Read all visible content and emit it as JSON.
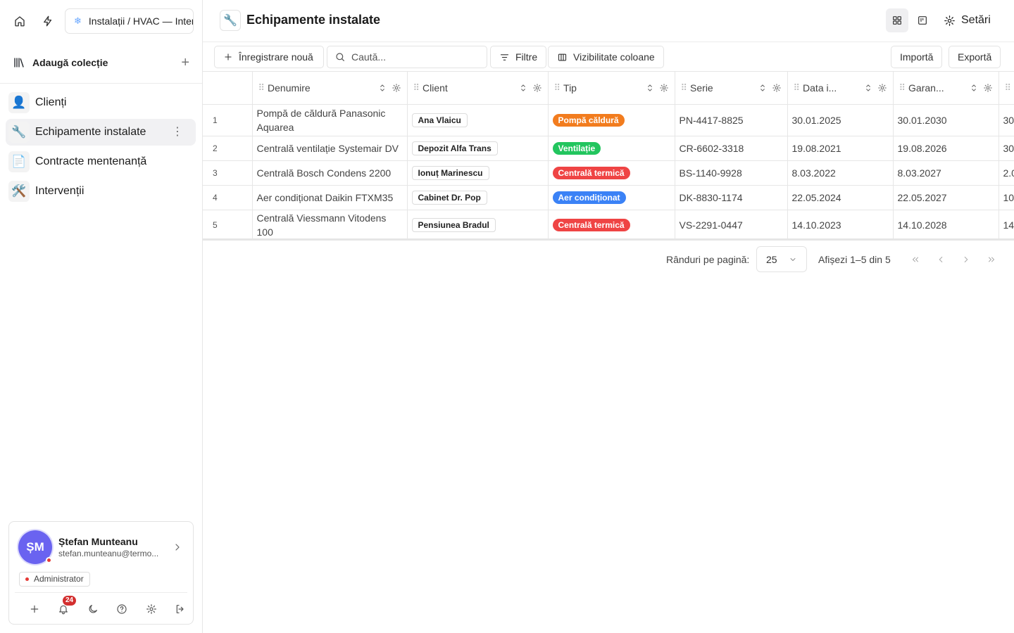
{
  "workspace": {
    "name": "Instalații / HVAC — Interne"
  },
  "sidebar": {
    "collections_label": "Adaugă colecție",
    "items": [
      {
        "emoji": "👤",
        "label": "Clienți"
      },
      {
        "emoji": "🔧",
        "label": "Echipamente instalate"
      },
      {
        "emoji": "📄",
        "label": "Contracte mentenanță"
      },
      {
        "emoji": "🛠️",
        "label": "Intervenții"
      }
    ]
  },
  "user": {
    "initials": "ȘM",
    "name": "Ștefan Munteanu",
    "email": "stefan.munteanu@termo...",
    "role": "Administrator",
    "notifications": "24"
  },
  "header": {
    "icon": "🔧",
    "title": "Echipamente instalate",
    "settings_label": "Setări"
  },
  "toolbar": {
    "new_record": "Înregistrare nouă",
    "search_placeholder": "Caută...",
    "filters": "Filtre",
    "columns": "Vizibilitate coloane",
    "import": "Importă",
    "export": "Exportă"
  },
  "table": {
    "columns": [
      "Denumire",
      "Client",
      "Tip",
      "Serie",
      "Data i...",
      "Garan..."
    ],
    "rows": [
      {
        "idx": "1",
        "name": "Pompă de căldură Panasonic Aquarea",
        "client": "Ana Vlaicu",
        "type": "Pompă căldură",
        "type_color": "#f27c1e",
        "serial": "PN-4417-8825",
        "date": "30.01.2025",
        "warranty": "30.01.2030",
        "extra": "30"
      },
      {
        "idx": "2",
        "name": "Centrală ventilație Systemair DV",
        "client": "Depozit Alfa Trans",
        "type": "Ventilație",
        "type_color": "#22c55e",
        "serial": "CR-6602-3318",
        "date": "19.08.2021",
        "warranty": "19.08.2026",
        "extra": "30"
      },
      {
        "idx": "3",
        "name": "Centrală Bosch Condens 2200",
        "client": "Ionuț Marinescu",
        "type": "Centrală termică",
        "type_color": "#ef4444",
        "serial": "BS-1140-9928",
        "date": "8.03.2022",
        "warranty": "8.03.2027",
        "extra": "2.0"
      },
      {
        "idx": "4",
        "name": "Aer condiționat Daikin FTXM35",
        "client": "Cabinet Dr. Pop",
        "type": "Aer condiționat",
        "type_color": "#3b82f6",
        "serial": "DK-8830-1174",
        "date": "22.05.2024",
        "warranty": "22.05.2027",
        "extra": "10"
      },
      {
        "idx": "5",
        "name": "Centrală Viessmann Vitodens 100",
        "client": "Pensiunea Bradul",
        "type": "Centrală termică",
        "type_color": "#ef4444",
        "serial": "VS-2291-0447",
        "date": "14.10.2023",
        "warranty": "14.10.2028",
        "extra": "14"
      }
    ]
  },
  "pagination": {
    "rows_per_page_label": "Rânduri pe pagină:",
    "rows_per_page": "25",
    "range": "Afișezi 1–5 din 5"
  }
}
